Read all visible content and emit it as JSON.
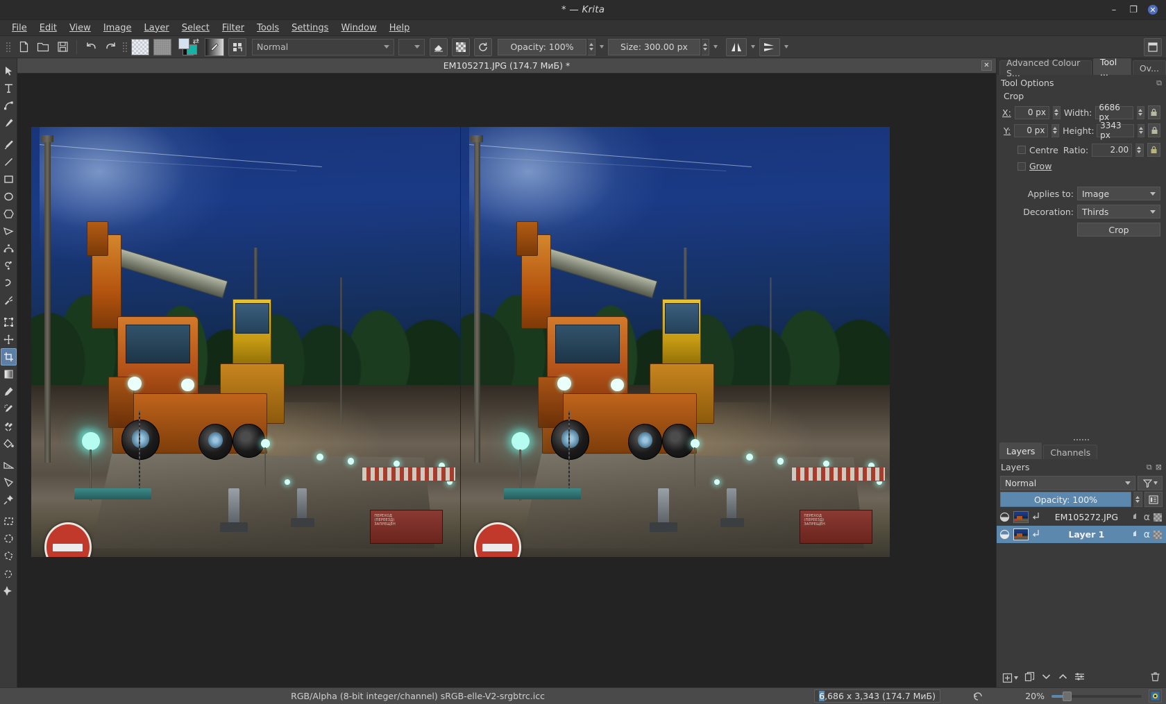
{
  "titlebar": {
    "title": "* — Krita",
    "minimize": "–",
    "maximize": "❐",
    "close": "✕"
  },
  "menubar": {
    "items": [
      {
        "label": "File"
      },
      {
        "label": "Edit"
      },
      {
        "label": "View"
      },
      {
        "label": "Image"
      },
      {
        "label": "Layer"
      },
      {
        "label": "Select"
      },
      {
        "label": "Filter"
      },
      {
        "label": "Tools"
      },
      {
        "label": "Settings"
      },
      {
        "label": "Window"
      },
      {
        "label": "Help"
      }
    ]
  },
  "toolbar": {
    "new_icon": "new-document-icon",
    "open_icon": "open-folder-icon",
    "save_icon": "save-icon",
    "undo_icon": "undo-icon",
    "redo_icon": "redo-icon",
    "blend_mode": "Normal",
    "eraser_icon": "eraser-icon",
    "preserve_alpha_icon": "preserve-alpha-icon",
    "reload_icon": "reload-preset-icon",
    "opacity": "Opacity: 100%",
    "size": "Size: 300.00 px",
    "mirror_h_icon": "mirror-horizontal-icon",
    "mirror_v_icon": "mirror-vertical-icon",
    "workspace_icon": "workspace-chooser-icon"
  },
  "tools": {
    "items": [
      {
        "name": "select-shapes-tool",
        "icon": "cursor-arrow-icon",
        "active": false
      },
      {
        "name": "text-tool",
        "icon": "text-T-icon",
        "active": false
      },
      {
        "name": "edit-shapes-tool",
        "icon": "node-edit-icon",
        "active": false
      },
      {
        "name": "calligraphy-tool",
        "icon": "calligraphy-pen-icon",
        "active": false
      },
      {
        "name": "freehand-brush-tool",
        "icon": "paintbrush-icon",
        "active": false
      },
      {
        "name": "line-tool",
        "icon": "line-icon",
        "active": false
      },
      {
        "name": "rectangle-tool",
        "icon": "rectangle-icon",
        "active": false
      },
      {
        "name": "ellipse-tool",
        "icon": "ellipse-icon",
        "active": false
      },
      {
        "name": "polygon-tool",
        "icon": "polygon-icon",
        "active": false
      },
      {
        "name": "polyline-tool",
        "icon": "polyline-icon",
        "active": false
      },
      {
        "name": "bezier-curve-tool",
        "icon": "bezier-curve-icon",
        "active": false
      },
      {
        "name": "freehand-path-tool",
        "icon": "freehand-path-icon",
        "active": false
      },
      {
        "name": "dynamic-brush-tool",
        "icon": "dynamic-brush-icon",
        "active": false
      },
      {
        "name": "multibrush-tool",
        "icon": "multibrush-icon",
        "active": false
      },
      {
        "name": "transform-tool",
        "icon": "transform-icon",
        "active": false
      },
      {
        "name": "move-tool",
        "icon": "move-cross-icon",
        "active": false
      },
      {
        "name": "crop-tool",
        "icon": "crop-icon",
        "active": true
      },
      {
        "name": "gradient-tool",
        "icon": "gradient-icon",
        "active": false
      },
      {
        "name": "colour-picker-tool",
        "icon": "eyedropper-icon",
        "active": false
      },
      {
        "name": "colourize-mask-tool",
        "icon": "colourize-mask-icon",
        "active": false
      },
      {
        "name": "smart-patch-tool",
        "icon": "smart-patch-icon",
        "active": false
      },
      {
        "name": "fill-tool",
        "icon": "paint-bucket-icon",
        "active": false
      },
      {
        "name": "measure-tool",
        "icon": "ruler-icon",
        "active": false
      },
      {
        "name": "angle-measure-tool",
        "icon": "angle-icon",
        "active": false
      },
      {
        "name": "reference-pin-tool",
        "icon": "pin-icon",
        "active": false
      },
      {
        "name": "rectangular-select-tool",
        "icon": "rect-select-icon",
        "active": false
      },
      {
        "name": "elliptical-select-tool",
        "icon": "ellipse-select-icon",
        "active": false
      },
      {
        "name": "polygonal-select-tool",
        "icon": "polygon-select-icon",
        "active": false
      },
      {
        "name": "freehand-select-tool",
        "icon": "lasso-select-icon",
        "active": false
      },
      {
        "name": "contiguous-select-tool",
        "icon": "magic-wand-icon",
        "active": false
      },
      {
        "name": "similar-colour-select-tool",
        "icon": "similar-select-icon",
        "active": false
      },
      {
        "name": "bezier-select-tool",
        "icon": "bezier-select-icon",
        "active": false
      },
      {
        "name": "magnetic-select-tool",
        "icon": "magnetic-select-icon",
        "active": false
      },
      {
        "name": "zoom-tool",
        "icon": "zoom-icon",
        "active": false
      }
    ]
  },
  "document": {
    "tab_title": "EM105271.JPG (174.7 МиБ) *",
    "close_label": "✕"
  },
  "right_dock": {
    "tabs": [
      {
        "label": "Advanced Colour S...",
        "active": false,
        "name": "tab-advanced-colour-selector"
      },
      {
        "label": "Tool ...",
        "active": true,
        "name": "tab-tool-options"
      },
      {
        "label": "Ov...",
        "active": false,
        "name": "tab-overview"
      }
    ],
    "tool_options": {
      "header": "Tool Options",
      "section": "Crop",
      "x_label": "X:",
      "x_value": "0 px",
      "y_label": "Y:",
      "y_value": "0 px",
      "width_label": "Width:",
      "width_value": "6686 px",
      "height_label": "Height:",
      "height_value": "3343 px",
      "centre_label": "Centre",
      "centre_checked": false,
      "grow_label": "Grow",
      "grow_checked": false,
      "ratio_label": "Ratio:",
      "ratio_value": "2.00",
      "applies_to_label": "Applies to:",
      "applies_to_value": "Image",
      "decoration_label": "Decoration:",
      "decoration_value": "Thirds",
      "crop_button": "Crop",
      "lock_icon": "padlock-icon",
      "float_icon": "float-dock-icon"
    }
  },
  "layers_dock": {
    "tabs": [
      {
        "label": "Layers",
        "active": true,
        "name": "tab-layers"
      },
      {
        "label": "Channels",
        "active": false,
        "name": "tab-channels"
      }
    ],
    "header": "Layers",
    "float_icon": "float-dock-icon",
    "close_icon": "close-dock-icon",
    "blend_mode": "Normal",
    "filter_icon": "filter-funnel-icon",
    "opacity": "Opacity:  100%",
    "properties_icon": "layer-properties-icon",
    "rows": [
      {
        "name": "EM105272.JPG",
        "selected": false,
        "visible_icon": "eye-visible-icon",
        "inherit_alpha_icon": "inherit-alpha-icon",
        "alpha_icon": "alpha-lock-icon",
        "onion_icon": "transparency-checker-icon"
      },
      {
        "name": "Layer 1",
        "selected": true,
        "visible_icon": "eye-visible-icon",
        "inherit_alpha_icon": "inherit-alpha-icon",
        "alpha_icon": "alpha-lock-icon",
        "onion_icon": "transparency-checker-icon"
      }
    ],
    "bottom_buttons": [
      {
        "name": "add-layer-button",
        "icon": "plus-square-icon"
      },
      {
        "name": "duplicate-layer-button",
        "icon": "duplicate-icon"
      },
      {
        "name": "move-layer-down-button",
        "icon": "chevron-down-icon"
      },
      {
        "name": "move-layer-up-button",
        "icon": "chevron-up-icon"
      },
      {
        "name": "layer-properties-button",
        "icon": "sliders-icon"
      },
      {
        "name": "delete-layer-button",
        "icon": "trash-icon"
      }
    ]
  },
  "statusbar": {
    "colour_space": "RGB/Alpha (8-bit integer/channel)  sRGB-elle-V2-srgbtrc.icc",
    "image_size_prefix": "6",
    "image_size_rest": ",686 x 3,343 (174.7 МиБ)",
    "reset_icon": "reset-zoom-icon",
    "zoom": "20%",
    "canvas_icon": "canvas-preview-icon"
  }
}
